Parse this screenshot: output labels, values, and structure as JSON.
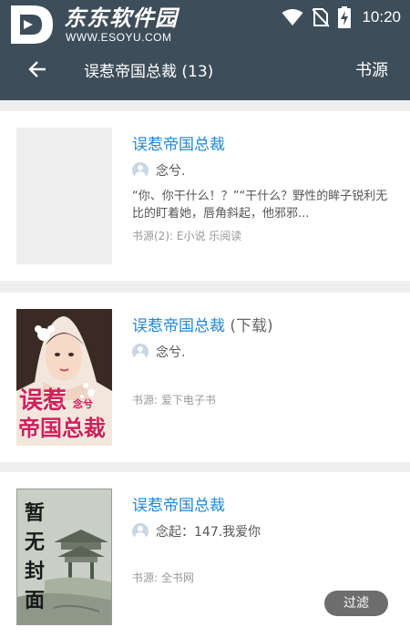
{
  "watermark": {
    "title": "东东软件园",
    "url": "WWW.ESOYU.COM"
  },
  "status_bar": {
    "time": "10:20",
    "icons": [
      "wifi-icon",
      "no-sim-icon",
      "battery-charging-icon"
    ]
  },
  "toolbar": {
    "title": "误惹帝国总裁 (13)",
    "source_label": "书源",
    "back_icon": "arrow-left-icon"
  },
  "results": [
    {
      "title": "误惹帝国总裁",
      "title_suffix": "",
      "author": "念兮.",
      "intro": "“你、你干什么！？”“干什么？野性的眸子锐利无比的盯着她，唇角斜起，他邪邪...",
      "source": "书源(2): E小说 乐阅读",
      "cover": "blank"
    },
    {
      "title": "误惹帝国总裁",
      "title_suffix": " (下载)",
      "author": "念兮.",
      "intro": "",
      "source": "书源: 爱下电子书",
      "cover": "illustrated",
      "cover_text": [
        "误惹",
        "帝国总裁"
      ],
      "cover_author": "念兮"
    },
    {
      "title": "误惹帝国总裁",
      "title_suffix": "",
      "author": "念起：147.我爱你",
      "intro": "",
      "source": "书源: 全书网",
      "cover": "placeholder",
      "cover_text": [
        "暂",
        "无",
        "封",
        "面"
      ]
    }
  ],
  "filter_button": "过滤",
  "colors": {
    "app_bar": "#3d4d59",
    "title_link": "#1e88d4",
    "background": "#eeeeee"
  }
}
